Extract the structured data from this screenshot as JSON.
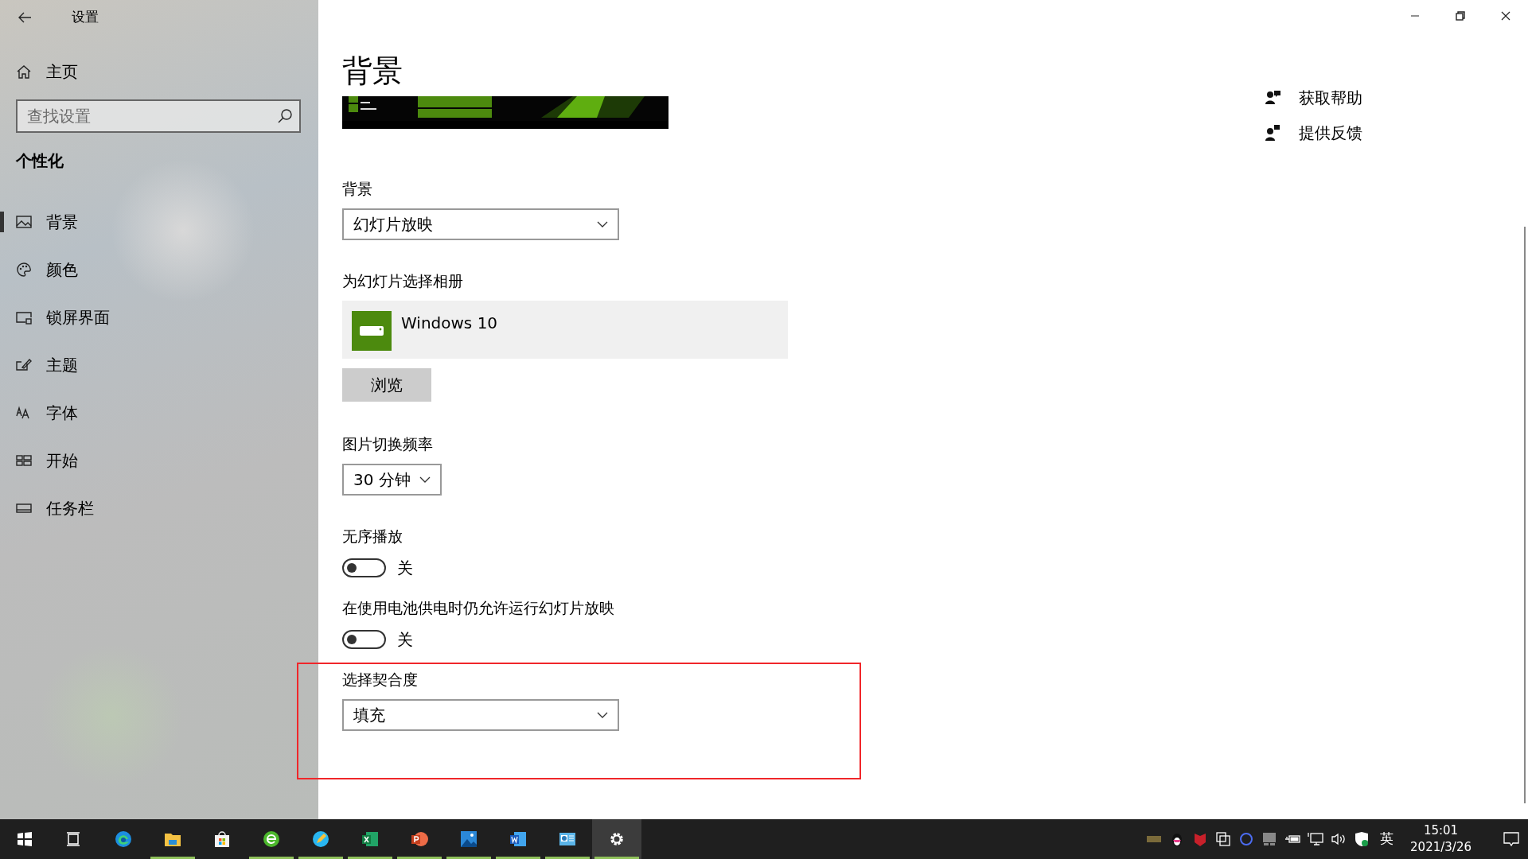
{
  "window": {
    "title": "设置"
  },
  "sidebar": {
    "home": "主页",
    "search": {
      "placeholder": "查找设置"
    },
    "section": "个性化",
    "items": [
      {
        "label": "背景",
        "selected": true
      },
      {
        "label": "颜色",
        "selected": false
      },
      {
        "label": "锁屏界面",
        "selected": false
      },
      {
        "label": "主题",
        "selected": false
      },
      {
        "label": "字体",
        "selected": false
      },
      {
        "label": "开始",
        "selected": false
      },
      {
        "label": "任务栏",
        "selected": false
      }
    ]
  },
  "page": {
    "title": "背景",
    "settings": [
      {
        "kind": "dropdown",
        "label": "背景",
        "value": "幻灯片放映"
      },
      {
        "kind": "album",
        "label": "为幻灯片选择相册",
        "album": "Windows 10"
      },
      {
        "kind": "button",
        "label": "浏览"
      },
      {
        "kind": "short-dropdown",
        "label": "图片切换频率",
        "value": "30 分钟"
      },
      {
        "kind": "toggle",
        "label": "无序播放",
        "on": false,
        "state_text": "关"
      },
      {
        "kind": "toggle",
        "label": "在使用电池供电时仍允许运行幻灯片放映",
        "on": false,
        "state_text": "关"
      },
      {
        "kind": "dropdown",
        "label": "选择契合度",
        "value": "填充",
        "highlighted": true
      }
    ]
  },
  "help_links": [
    {
      "label": "获取帮助"
    },
    {
      "label": "提供反馈"
    }
  ],
  "taskbar": {
    "apps": [
      {
        "kind": "start",
        "running": false,
        "active": false
      },
      {
        "kind": "taskview",
        "running": false,
        "active": false
      },
      {
        "kind": "edge",
        "running": false,
        "active": false
      },
      {
        "kind": "explorer",
        "running": true,
        "active": false
      },
      {
        "kind": "store",
        "running": false,
        "active": false
      },
      {
        "kind": "browser360",
        "running": true,
        "active": false
      },
      {
        "kind": "pencil",
        "running": true,
        "active": false
      },
      {
        "kind": "excel",
        "running": true,
        "active": false
      },
      {
        "kind": "powerpoint",
        "running": true,
        "active": false
      },
      {
        "kind": "photos",
        "running": true,
        "active": false
      },
      {
        "kind": "word",
        "running": true,
        "active": false
      },
      {
        "kind": "presenter",
        "running": true,
        "active": false
      },
      {
        "kind": "settings",
        "running": true,
        "active": true
      }
    ],
    "tray": {
      "ime": "英",
      "time": "15:01",
      "date": "2021/3/26"
    }
  }
}
